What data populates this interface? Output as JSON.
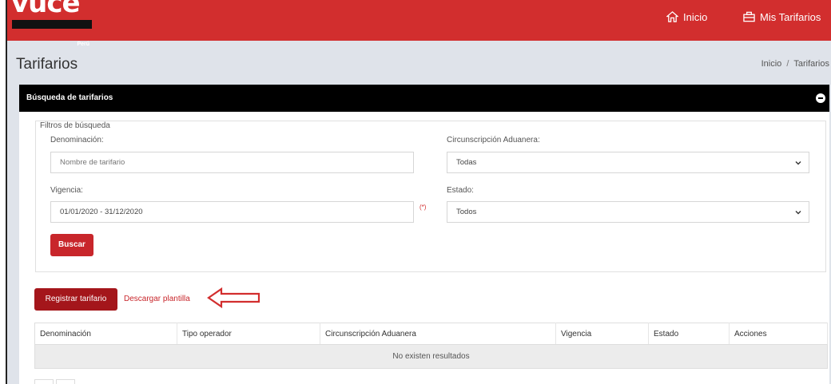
{
  "brand": {
    "logo_text": "vuce",
    "logo_subtext": "Perú"
  },
  "header": {
    "nav": [
      {
        "label": "Inicio",
        "icon": "home-icon"
      },
      {
        "label": "Mis Tarifarios",
        "icon": "briefcase-icon"
      }
    ]
  },
  "page": {
    "title": "Tarifarios",
    "breadcrumb": [
      "Inicio",
      "Tarifarios"
    ],
    "breadcrumb_separator": "/"
  },
  "search_panel": {
    "title": "Búsqueda de tarifarios",
    "fieldset_legend": "Filtros de búsqueda",
    "denominacion": {
      "label": "Denominación:",
      "placeholder": "Nombre de tarifario"
    },
    "circunscripcion": {
      "label": "Circunscripción Aduanera:",
      "value": "Todas"
    },
    "vigencia": {
      "label": "Vigencia:",
      "value": "01/01/2020 - 31/12/2020",
      "required_mark": "(*)"
    },
    "estado": {
      "label": "Estado:",
      "value": "Todos"
    },
    "search_button": "Buscar"
  },
  "actions": {
    "register_button": "Registrar tarifario",
    "download_link": "Descargar plantilla"
  },
  "results_table": {
    "columns": [
      "Denominación",
      "Tipo operador",
      "Circunscripción Aduanera",
      "Vigencia",
      "Estado",
      "Acciones"
    ],
    "empty_message": "No existen resultados"
  },
  "colors": {
    "brand_red": "#d22e2e",
    "button_red": "#c8262b",
    "register_red": "#a4161b",
    "header_black": "#000000",
    "page_bg": "#dfe3ea"
  }
}
